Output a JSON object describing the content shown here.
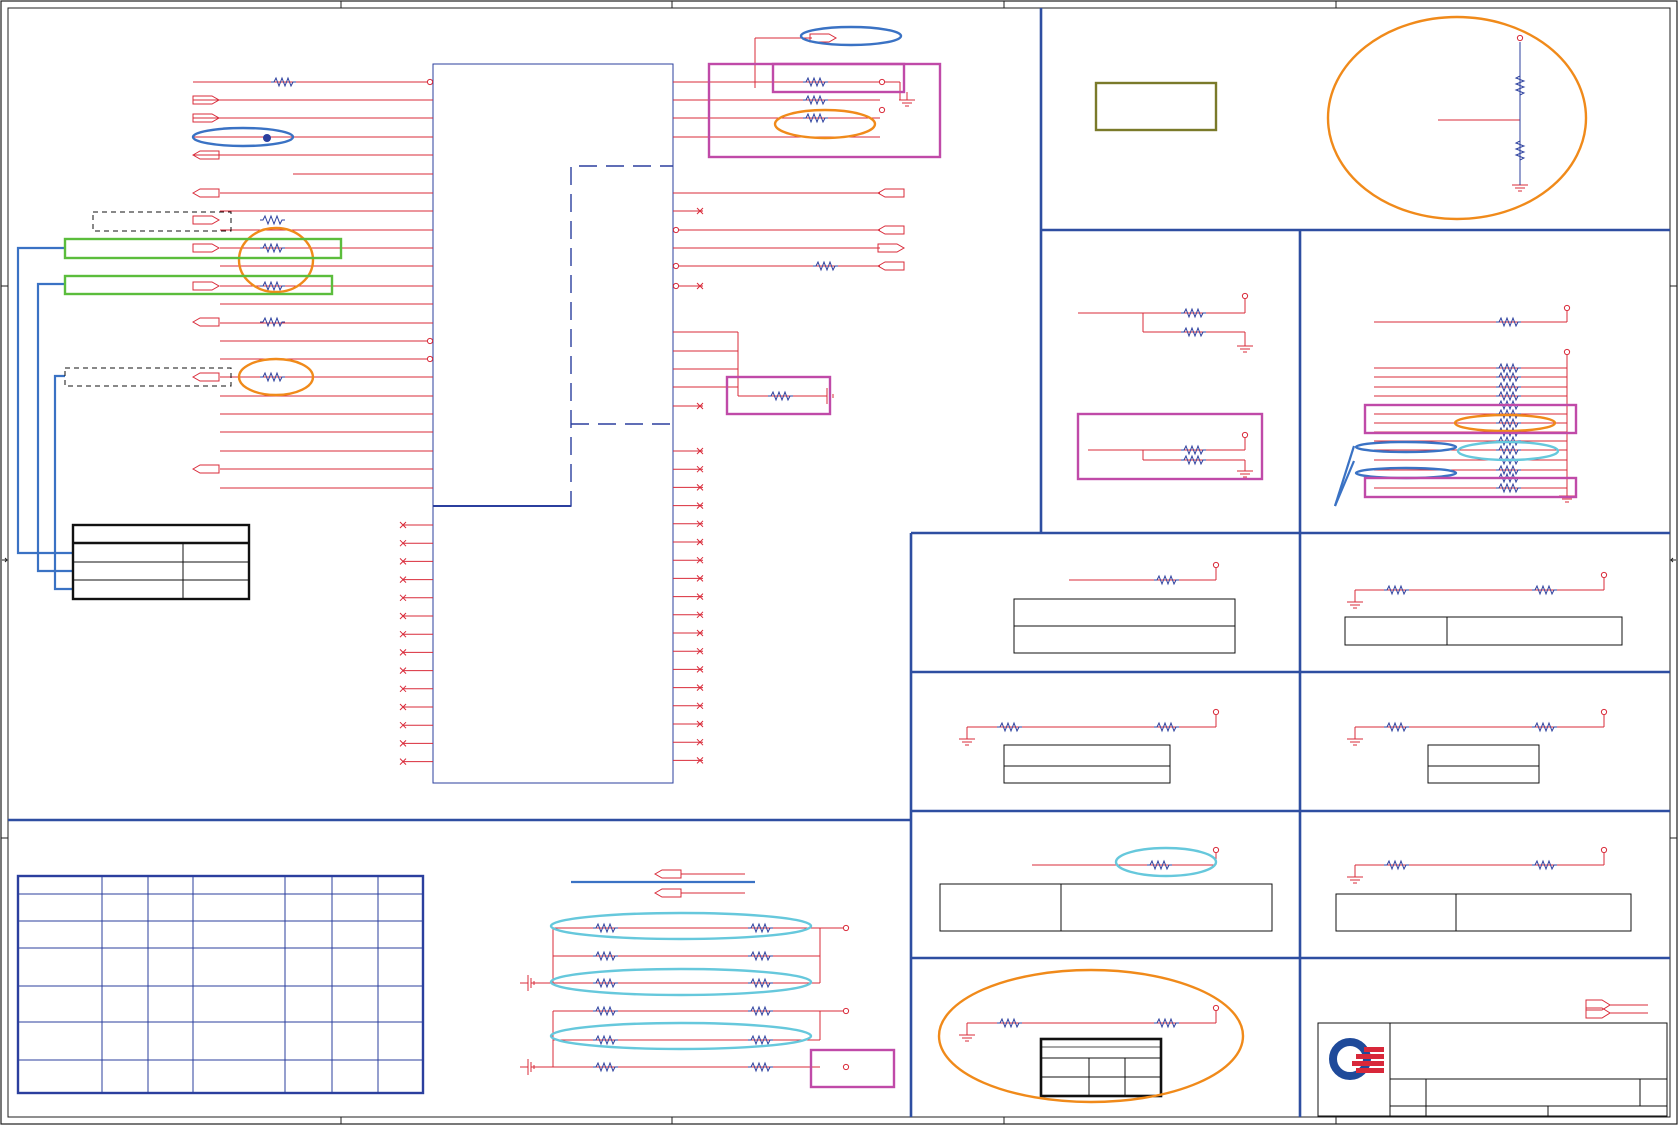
{
  "sheet": {
    "description": "",
    "colors": {
      "border": "#1f1f1f",
      "section_line": "#2e4ea1",
      "signal_wire": "#d92b3a",
      "resistor": "#2b3f9e",
      "chip_outline": "#2b3f9e",
      "annotation_orange": "#f08a1a",
      "annotation_blue": "#3a72c4",
      "annotation_cyan": "#66c8dc",
      "annotation_green": "#5bbd3c",
      "annotation_magenta": "#c04aa8",
      "annotation_olive": "#7a7a2a",
      "table_black": "#111111",
      "logo_blue": "#1f4a9a",
      "logo_red": "#d8283a"
    },
    "icons": [
      "ground-symbol",
      "power-pin",
      "no-connect-mark",
      "resistor-symbol",
      "off-page-connector",
      "company-logo"
    ]
  }
}
